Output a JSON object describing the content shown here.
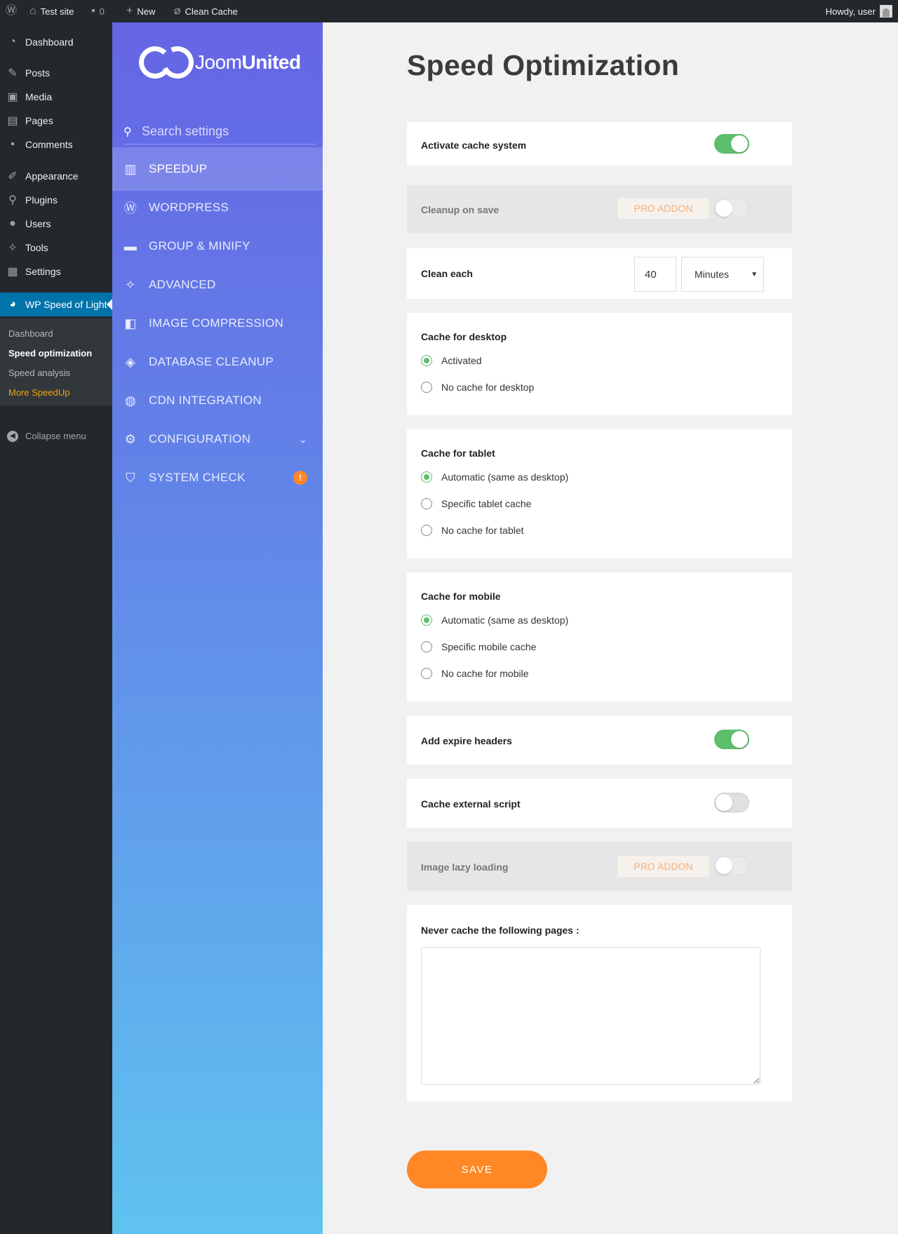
{
  "adminbar": {
    "wp_logo": "wordpress-icon",
    "site_name": "Test site",
    "comments_count": "0",
    "new_label": "New",
    "clean_cache_label": "Clean Cache",
    "howdy": "Howdy, user"
  },
  "adminmenu": {
    "items": [
      {
        "label": "Dashboard",
        "icon": "dashboard-icon"
      },
      {
        "label": "Posts",
        "icon": "pin-icon"
      },
      {
        "label": "Media",
        "icon": "media-icon"
      },
      {
        "label": "Pages",
        "icon": "pages-icon"
      },
      {
        "label": "Comments",
        "icon": "comments-icon"
      },
      {
        "label": "Appearance",
        "icon": "brush-icon"
      },
      {
        "label": "Plugins",
        "icon": "plugin-icon"
      },
      {
        "label": "Users",
        "icon": "users-icon"
      },
      {
        "label": "Tools",
        "icon": "wrench-icon"
      },
      {
        "label": "Settings",
        "icon": "settings-icon"
      },
      {
        "label": "WP Speed of Light",
        "icon": "gauge-icon"
      }
    ],
    "submenu": [
      {
        "label": "Dashboard"
      },
      {
        "label": "Speed optimization"
      },
      {
        "label": "Speed analysis"
      },
      {
        "label": "More SpeedUp"
      }
    ],
    "collapse_label": "Collapse menu"
  },
  "plugin_sidebar": {
    "logo_text_light": "Joom",
    "logo_text_bold": "United",
    "search_placeholder": "Search settings",
    "nav": [
      {
        "label": "SPEEDUP",
        "icon": "chart-icon"
      },
      {
        "label": "WORDPRESS",
        "icon": "wordpress-icon"
      },
      {
        "label": "GROUP & MINIFY",
        "icon": "folder-icon"
      },
      {
        "label": "ADVANCED",
        "icon": "wrench-icon"
      },
      {
        "label": "IMAGE COMPRESSION",
        "icon": "image-compress-icon"
      },
      {
        "label": "DATABASE CLEANUP",
        "icon": "layers-icon"
      },
      {
        "label": "CDN INTEGRATION",
        "icon": "globe-icon"
      },
      {
        "label": "CONFIGURATION",
        "icon": "gear-icon"
      },
      {
        "label": "SYSTEM CHECK",
        "icon": "shield-check-icon",
        "badge": "!"
      }
    ]
  },
  "main": {
    "title": "Speed Optimization",
    "activate_cache": {
      "label": "Activate cache system",
      "on": true
    },
    "cleanup_on_save": {
      "label": "Cleanup on save",
      "badge": "PRO ADDON",
      "on": false
    },
    "clean_each": {
      "label": "Clean each",
      "value": "40",
      "unit": "Minutes"
    },
    "cache_desktop": {
      "label": "Cache for desktop",
      "options": [
        "Activated",
        "No cache for desktop"
      ],
      "selected": 0
    },
    "cache_tablet": {
      "label": "Cache for tablet",
      "options": [
        "Automatic (same as desktop)",
        "Specific tablet cache",
        "No cache for tablet"
      ],
      "selected": 0
    },
    "cache_mobile": {
      "label": "Cache for mobile",
      "options": [
        "Automatic (same as desktop)",
        "Specific mobile cache",
        "No cache for mobile"
      ],
      "selected": 0
    },
    "expire_headers": {
      "label": "Add expire headers",
      "on": true
    },
    "external_script": {
      "label": "Cache external script",
      "on": false
    },
    "lazy_loading": {
      "label": "Image lazy loading",
      "badge": "PRO ADDON",
      "on": false
    },
    "never_cache": {
      "label": "Never cache the following pages :",
      "value": ""
    },
    "save_label": "SAVE"
  },
  "colors": {
    "accent_orange": "#ff8726",
    "toggle_green": "#5dbe6b",
    "wp_blue": "#0073aa",
    "admin_dark": "#23282d"
  }
}
